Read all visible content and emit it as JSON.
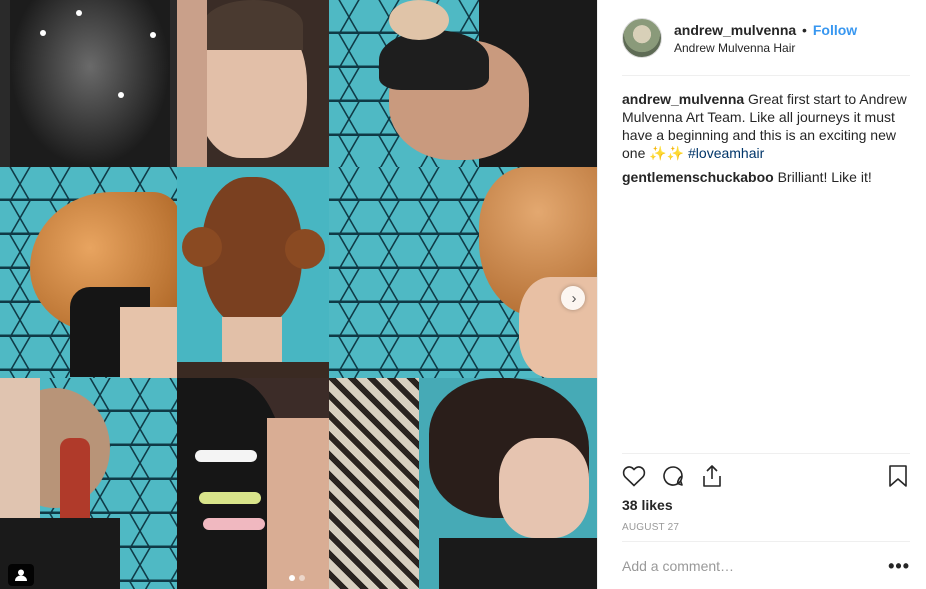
{
  "post": {
    "media_alt": "Hair styling collage",
    "carousel": {
      "total": 2,
      "current": 1
    }
  },
  "header": {
    "username": "andrew_mulvenna",
    "separator": "•",
    "follow_label": "Follow",
    "location": "Andrew Mulvenna Hair"
  },
  "comments": [
    {
      "user": "andrew_mulvenna",
      "text": "Great first start to Andrew Mulvenna Art Team. Like all journeys it must have a beginning and this is an exciting new one ✨✨",
      "hashtag": "#loveamhair"
    },
    {
      "user": "gentlemenschuckaboo",
      "text": "Brilliant! Like it!"
    }
  ],
  "engagement": {
    "likes": "38 likes",
    "date": "AUGUST 27"
  },
  "add_comment": {
    "placeholder": "Add a comment…",
    "more": "•••"
  },
  "icons": {
    "like": "heart-icon",
    "comment": "comment-icon",
    "share": "share-icon",
    "save": "bookmark-icon",
    "next": "chevron-right-icon",
    "tagged": "user-tag-icon"
  },
  "colors": {
    "follow": "#3897f0",
    "hashtag": "#003569",
    "muted": "#999999",
    "text": "#262626"
  }
}
